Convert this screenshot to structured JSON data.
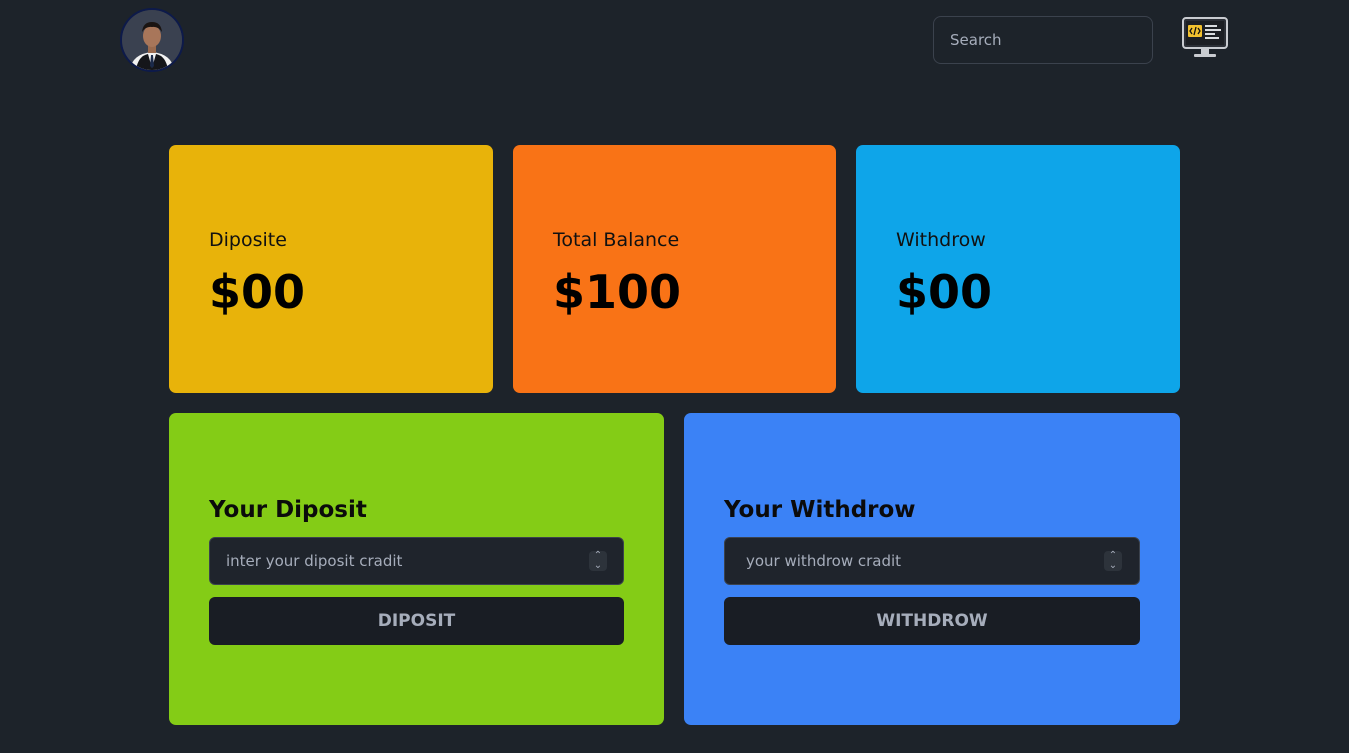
{
  "header": {
    "search_placeholder": "Search",
    "avatar_icon": "user-avatar",
    "dev_icon": "code-monitor-icon"
  },
  "stats": [
    {
      "label": "Diposite",
      "value": "$00",
      "color": "#e8b30a"
    },
    {
      "label": "Total Balance",
      "value": "$100",
      "color": "#f97316"
    },
    {
      "label": "Withdrow",
      "value": "$00",
      "color": "#0ea5e9"
    }
  ],
  "deposit_panel": {
    "title": "Your Diposit",
    "input_placeholder": "inter your diposit cradit",
    "button_label": "DIPOSIT",
    "color": "#84cc16"
  },
  "withdraw_panel": {
    "title": "Your Withdrow",
    "input_placeholder": "your withdrow cradit",
    "button_label": "WITHDROW",
    "color": "#3b82f6"
  }
}
